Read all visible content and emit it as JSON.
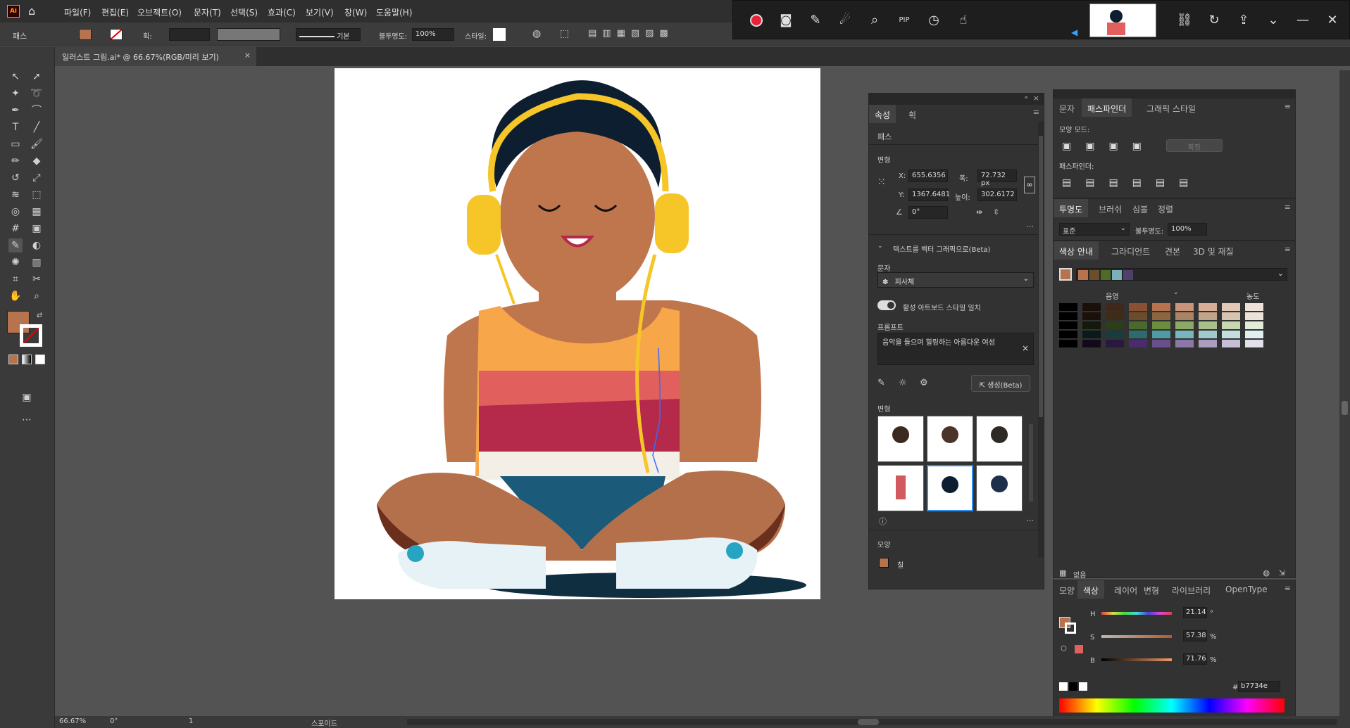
{
  "app": {
    "logo": "Ai",
    "menus": [
      "파일(F)",
      "편집(E)",
      "오브젝트(O)",
      "문자(T)",
      "선택(S)",
      "효과(C)",
      "보기(V)",
      "창(W)",
      "도움말(H)"
    ]
  },
  "control_bar": {
    "label": "패스",
    "stroke_label": "획:",
    "stroke_style": "기본",
    "opacity_label": "불투명도:",
    "opacity_value": "100%",
    "style_label": "스타일:"
  },
  "document_tab": {
    "title": "일러스트 그림.ai* @ 66.67%(RGB/미리 보기)"
  },
  "recorder": {
    "pip": "PIP"
  },
  "properties_panel": {
    "tabs": [
      "속성",
      "획"
    ],
    "section_path": "패스",
    "transform_title": "변형",
    "x_label": "X:",
    "x_value": "655.6356",
    "y_label": "Y:",
    "y_value": "1367.6481",
    "w_label": "폭:",
    "w_value": "72.732 px",
    "h_label": "높이:",
    "h_value": "302.6172",
    "angle_value": "0°",
    "vector_section": "텍스트를 벡터 그래픽으로(Beta)",
    "type_label": "문자",
    "type_value": "피사체",
    "toggle_label": "활성 아트보드 스타일 일치",
    "prompt_label": "프롬프트",
    "prompt_value": "음악을 들으며 힐링하는 아름다운 여성",
    "generate_btn": "생성(Beta)",
    "variations_label": "변형",
    "appearance_label": "모양",
    "fill_label": "칠"
  },
  "pathfinder_panel": {
    "tabs": [
      "문자",
      "패스파인더",
      "그래픽 스타일"
    ],
    "shape_modes": "모양 모드:",
    "expand_btn": "확장",
    "pathfinders": "패스파인더:"
  },
  "transparency_panel": {
    "tabs": [
      "투명도",
      "브러쉬",
      "심볼",
      "정렬"
    ],
    "blend_mode": "표준",
    "opacity_label": "불투명도:",
    "opacity_value": "100%"
  },
  "color_guide_panel": {
    "tabs": [
      "색상 안내",
      "그라디언트",
      "견본",
      "3D 및 재질"
    ],
    "shades_label": "음영",
    "tints_label": "농도",
    "footer_label": "없음",
    "harmony_colors": [
      "#b7734e",
      "#6b4f2a",
      "#4f6b2a",
      "#7ab0b8",
      "#4f3f6b"
    ],
    "grid": [
      [
        "#000000",
        "#1a0f0a",
        "#40281a",
        "#8a5034",
        "#b7734e",
        "#c9957a",
        "#d7ae98",
        "#e3c7b9",
        "#efe0d9"
      ],
      [
        "#000000",
        "#1a120a",
        "#3e2c19",
        "#6d4c2b",
        "#8d6540",
        "#a88464",
        "#c0a58b",
        "#d6c4b1",
        "#ebe2d8"
      ],
      [
        "#000000",
        "#141a0a",
        "#2d3e19",
        "#4a6a2b",
        "#6b8d40",
        "#8ba864",
        "#a9c08b",
        "#c6d6b1",
        "#e2ebd8"
      ],
      [
        "#000000",
        "#0a1a1a",
        "#193d3e",
        "#2b6a6d",
        "#4e9ba3",
        "#78b6bd",
        "#9fcbd0",
        "#c3dee1",
        "#e1eff0"
      ],
      [
        "#000000",
        "#120a1a",
        "#29193e",
        "#4a2b6d",
        "#6b4f8d",
        "#8b78a8",
        "#a99dc0",
        "#c7bfd6",
        "#e3dfeb"
      ]
    ]
  },
  "color_panel": {
    "tabs": [
      "모양",
      "색상",
      "레이어",
      "변형",
      "라이브러리",
      "OpenType"
    ],
    "h_label": "H",
    "h_value": "21.14",
    "h_unit": "°",
    "s_label": "S",
    "s_value": "57.38",
    "s_unit": "%",
    "b_label": "B",
    "b_value": "71.76",
    "b_unit": "%",
    "hex_label": "#",
    "hex_value": "b7734e"
  },
  "status_bar": {
    "zoom": "66.67%",
    "rotate": "0°",
    "artboard": "1",
    "tool": "스포이드"
  },
  "colors": {
    "fill": "#b7734e",
    "accent": "#2d8cf0"
  }
}
